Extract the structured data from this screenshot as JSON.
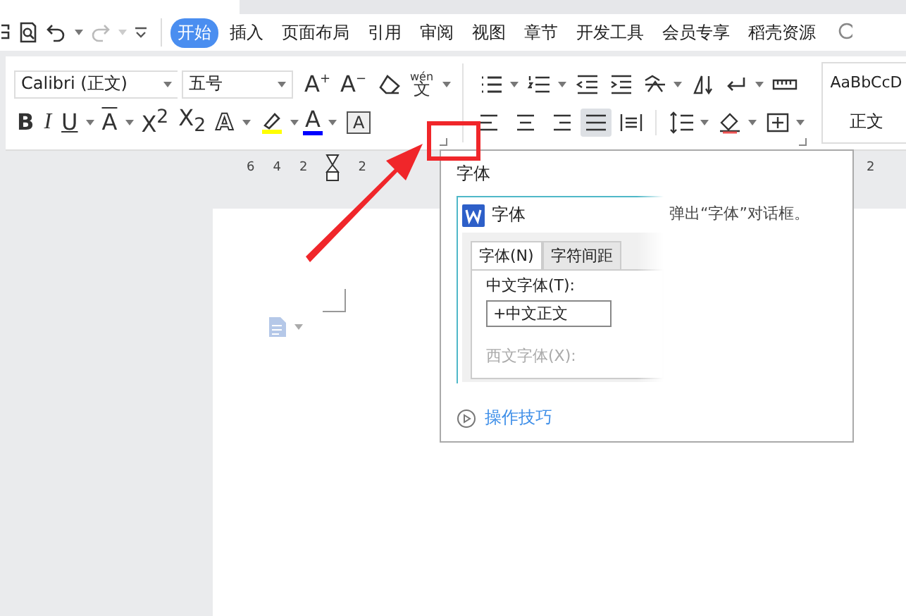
{
  "tabs": [
    {
      "label": "开始",
      "selected": true
    },
    {
      "label": "插入",
      "selected": false
    },
    {
      "label": "页面布局",
      "selected": false
    },
    {
      "label": "引用",
      "selected": false
    },
    {
      "label": "审阅",
      "selected": false
    },
    {
      "label": "视图",
      "selected": false
    },
    {
      "label": "章节",
      "selected": false
    },
    {
      "label": "开发工具",
      "selected": false
    },
    {
      "label": "会员专享",
      "selected": false
    },
    {
      "label": "稻壳资源",
      "selected": false
    }
  ],
  "font_family": {
    "value": "Calibri (正文)"
  },
  "font_size": {
    "value": "五号"
  },
  "font_tools": [
    {
      "kind": "grow",
      "label": "A",
      "mark": "+"
    },
    {
      "kind": "shrink",
      "label": "A",
      "mark": "−"
    },
    {
      "kind": "eraser"
    },
    {
      "kind": "phonetic",
      "label": "文",
      "mark": "wén"
    }
  ],
  "format_tools": [
    {
      "kind": "bold",
      "label": "B",
      "dropdown": false
    },
    {
      "kind": "italic",
      "label": "I",
      "dropdown": false
    },
    {
      "kind": "underline",
      "label": "U",
      "dropdown": true
    },
    {
      "kind": "strike",
      "label": "A",
      "dropdown": true
    },
    {
      "kind": "script",
      "label": "X$^{2}$",
      "dropdown": false
    },
    {
      "kind": "script",
      "label": "X$_{2}$",
      "dropdown": false
    },
    {
      "kind": "outline",
      "label": "A",
      "dropdown": true
    },
    {
      "kind": "highlight",
      "color": "#ffff00",
      "dropdown": true
    },
    {
      "kind": "color",
      "label": "A",
      "color": "#0000ff",
      "dropdown": true
    },
    {
      "kind": "boxed",
      "label": "A",
      "dropdown": false
    }
  ],
  "paragraph_row1": [
    {
      "kind": "bullets",
      "dropdown": true
    },
    {
      "kind": "numbering",
      "dropdown": true
    },
    {
      "kind": "outdent",
      "dropdown": false
    },
    {
      "kind": "indent",
      "dropdown": false
    },
    {
      "kind": "layout",
      "dropdown": true
    },
    {
      "kind": "direction",
      "dropdown": false
    },
    {
      "kind": "linebreak",
      "dropdown": true
    },
    {
      "kind": "ruler",
      "dropdown": false
    }
  ],
  "paragraph_row2": [
    {
      "kind": "left",
      "selected": false
    },
    {
      "kind": "center",
      "selected": false
    },
    {
      "kind": "right",
      "selected": false
    },
    {
      "kind": "justify",
      "selected": true
    },
    {
      "kind": "distribute",
      "selected": false
    }
  ],
  "paragraph_row2_more": [
    {
      "kind": "spacing",
      "dropdown": true
    },
    {
      "kind": "shading",
      "dropdown": true
    },
    {
      "kind": "borders",
      "dropdown": true
    }
  ],
  "style_gallery": {
    "preview": "AaBbCcD",
    "name": "正文"
  },
  "ruler": {
    "numbers": [
      "6",
      "4",
      "2",
      "2"
    ],
    "right_number": "2"
  },
  "tooltip": {
    "title": "字体",
    "description": "弹出“字体”对话框。",
    "link": "操作技巧",
    "preview": {
      "title": "字体",
      "tabs": [
        {
          "label": "字体(N)",
          "selected": true
        },
        {
          "label": "字符间距",
          "selected": false
        }
      ],
      "field_label": "中文字体(T):",
      "field_value": "+中文正文",
      "faded_label": "西文字体(X):"
    }
  }
}
